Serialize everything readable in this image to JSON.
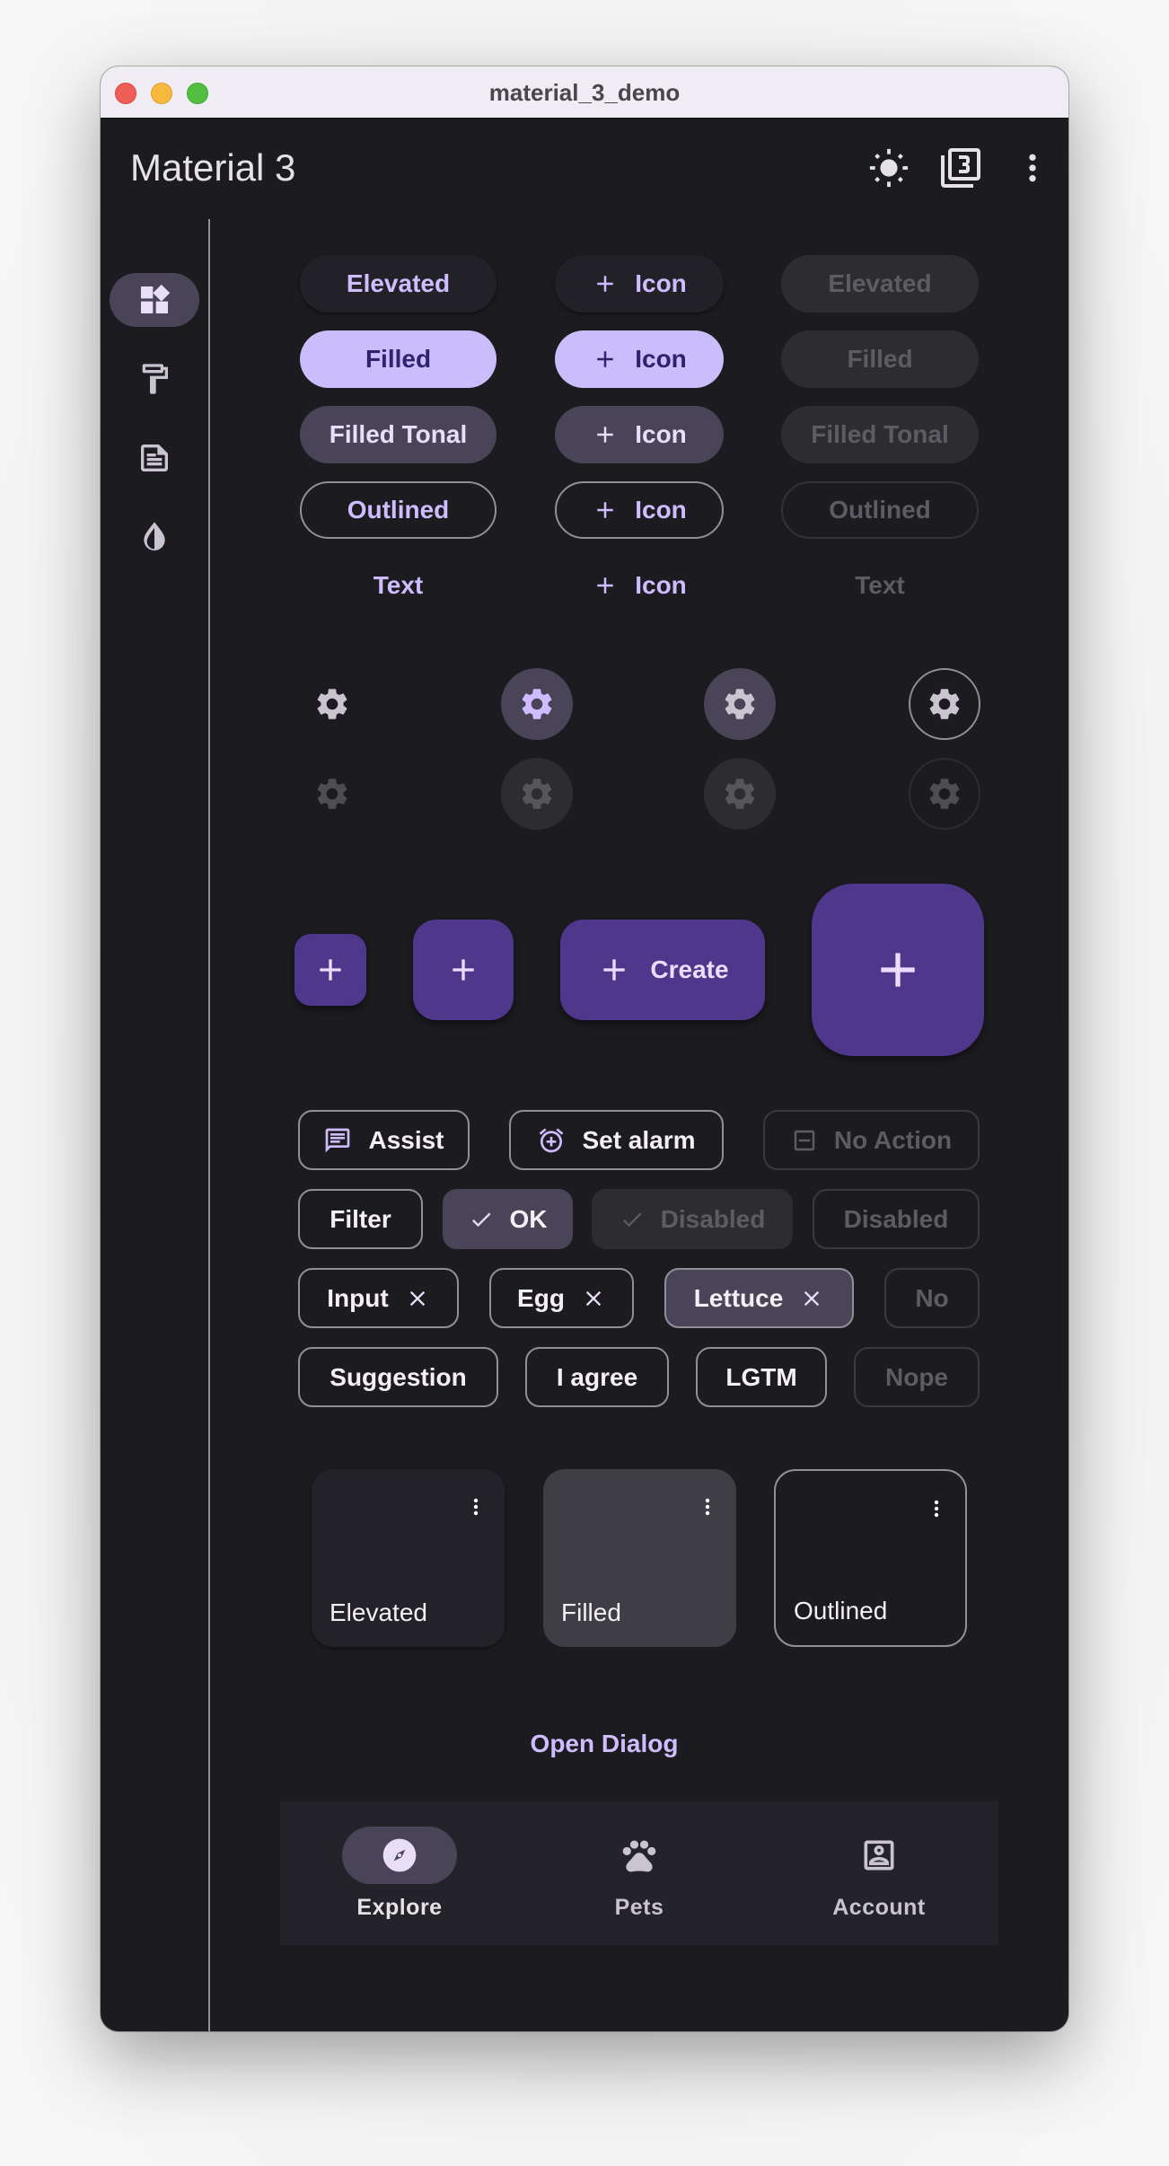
{
  "window": {
    "title": "material_3_demo"
  },
  "app_bar": {
    "title": "Material 3",
    "actions": [
      {
        "icon": "light-mode-icon",
        "label": "Toggle brightness"
      },
      {
        "icon": "filter-3-icon",
        "label": "Material version"
      },
      {
        "icon": "more-vert-icon",
        "label": "More"
      }
    ]
  },
  "rail": {
    "items": [
      {
        "icon": "widgets-icon",
        "selected": true
      },
      {
        "icon": "format-paint-icon",
        "selected": false
      },
      {
        "icon": "article-icon",
        "selected": false
      },
      {
        "icon": "invert-colors-icon",
        "selected": false
      }
    ]
  },
  "buttons": {
    "enabled": [
      "Elevated",
      "Filled",
      "Filled Tonal",
      "Outlined",
      "Text"
    ],
    "with_icon": [
      "Icon",
      "Icon",
      "Icon",
      "Icon",
      "Icon"
    ],
    "disabled": [
      "Elevated",
      "Filled",
      "Filled Tonal",
      "Outlined",
      "Text"
    ]
  },
  "icon_buttons": {
    "variants": [
      "standard",
      "filled",
      "filled-tonal",
      "outlined"
    ],
    "icon": "settings-icon"
  },
  "fabs": {
    "extended_label": "Create",
    "sizes": [
      "small",
      "regular",
      "extended",
      "large"
    ]
  },
  "chips": {
    "row1": [
      {
        "label": "Assist",
        "icon": "chat-icon",
        "state": "enabled"
      },
      {
        "label": "Set alarm",
        "icon": "alarm-add-icon",
        "state": "enabled"
      },
      {
        "label": "No Action",
        "icon": "indeterminate-box-icon",
        "state": "disabled"
      }
    ],
    "row2": [
      {
        "label": "Filter",
        "state": "enabled"
      },
      {
        "label": "OK",
        "state": "selected"
      },
      {
        "label": "Disabled",
        "state": "disabled-selected"
      },
      {
        "label": "Disabled",
        "state": "disabled"
      }
    ],
    "row3": [
      {
        "label": "Input",
        "state": "enabled"
      },
      {
        "label": "Egg",
        "state": "enabled"
      },
      {
        "label": "Lettuce",
        "state": "selected"
      },
      {
        "label": "No",
        "state": "disabled"
      }
    ],
    "row4": [
      {
        "label": "Suggestion",
        "state": "enabled"
      },
      {
        "label": "I agree",
        "state": "enabled"
      },
      {
        "label": "LGTM",
        "state": "enabled"
      },
      {
        "label": "Nope",
        "state": "disabled"
      }
    ]
  },
  "cards": [
    "Elevated",
    "Filled",
    "Outlined"
  ],
  "dialog_button": "Open Dialog",
  "navigation_bar": {
    "items": [
      {
        "label": "Explore",
        "icon": "explore-icon",
        "selected": true
      },
      {
        "label": "Pets",
        "icon": "pets-icon",
        "selected": false
      },
      {
        "label": "Account",
        "icon": "account-box-icon",
        "selected": false
      }
    ]
  },
  "colors": {
    "primary": "#cfbcff",
    "background": "#1c1b1f",
    "secondary_container": "#4a4458",
    "primary_container": "#4f378b",
    "outline": "#938f99"
  }
}
